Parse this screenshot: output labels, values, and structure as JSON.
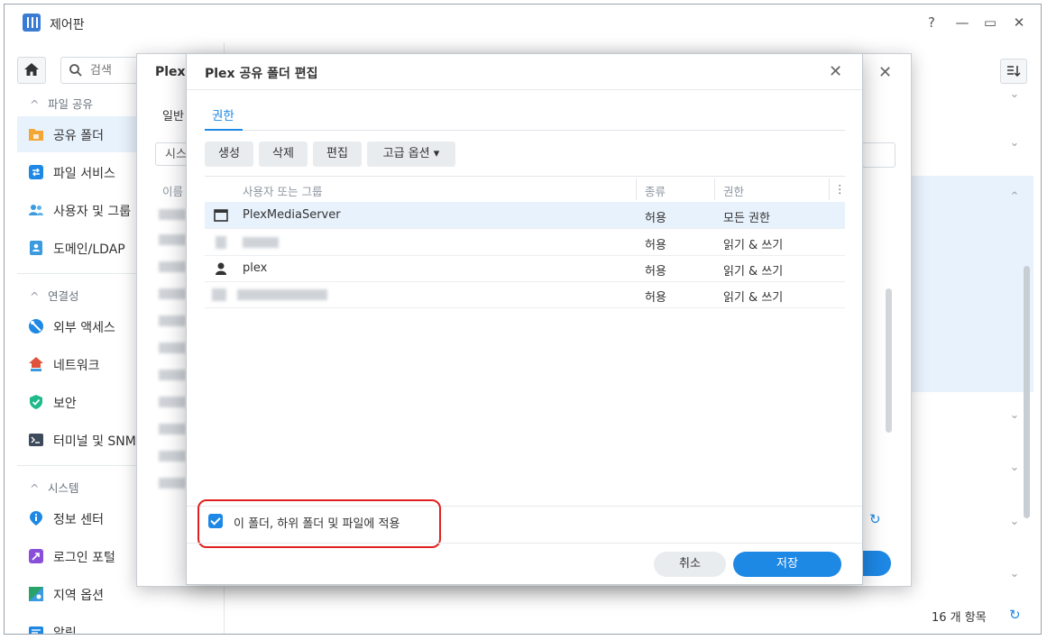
{
  "window": {
    "title": "제어판",
    "help": "?",
    "minimize": "—",
    "maximize": "▭",
    "close": "✕"
  },
  "sidebar": {
    "search_placeholder": "검색",
    "sections": [
      {
        "label": "파일 공유",
        "items": [
          {
            "label": "공유 폴더",
            "icon": "shared-folder-icon",
            "color": "#f3a633",
            "active": true
          },
          {
            "label": "파일 서비스",
            "icon": "file-services-icon",
            "color": "#1e88e5"
          },
          {
            "label": "사용자 및 그룹",
            "icon": "user-group-icon",
            "color": "#3a9be0"
          },
          {
            "label": "도메인/LDAP",
            "icon": "domain-ldap-icon",
            "color": "#3a9be0"
          }
        ]
      },
      {
        "label": "연결성",
        "items": [
          {
            "label": "외부 액세스",
            "icon": "external-access-icon",
            "color": "#1e88e5"
          },
          {
            "label": "네트워크",
            "icon": "network-icon",
            "color": "#e0533a"
          },
          {
            "label": "보안",
            "icon": "security-shield-icon",
            "color": "#1fb98a"
          },
          {
            "label": "터미널 및 SNMP",
            "icon": "terminal-icon",
            "color": "#3d4a5c"
          }
        ]
      },
      {
        "label": "시스템",
        "items": [
          {
            "label": "정보 센터",
            "icon": "info-center-icon",
            "color": "#1e88e5"
          },
          {
            "label": "로그인 포털",
            "icon": "login-portal-icon",
            "color": "#8a4fd8"
          },
          {
            "label": "지역 옵션",
            "icon": "regional-options-icon",
            "color": "#2aa36b"
          },
          {
            "label": "알림",
            "icon": "notification-icon",
            "color": "#1e88e5"
          }
        ]
      }
    ]
  },
  "right_panel": {
    "item_count": "16 개 항목"
  },
  "back_dialog": {
    "title": "Plex -",
    "tab": "일반",
    "field_text": "시스",
    "column_name": "이름"
  },
  "dialog": {
    "title": "Plex 공유 폴더 편집",
    "tab": "권한",
    "toolbar": {
      "create": "생성",
      "delete": "삭제",
      "edit": "편집",
      "advanced": "고급 옵션 ▾"
    },
    "columns": {
      "user": "사용자 또는 그룹",
      "type": "종류",
      "permission": "권한",
      "more": "⋮"
    },
    "rows": [
      {
        "name": "PlexMediaServer",
        "type": "허용",
        "permission": "모든 권한",
        "icon": "app-window-icon",
        "selected": true
      },
      {
        "name": "",
        "type": "허용",
        "permission": "읽기 & 쓰기",
        "icon": "redacted-icon",
        "blurred": true
      },
      {
        "name": "plex",
        "type": "허용",
        "permission": "읽기 & 쓰기",
        "icon": "user-icon"
      },
      {
        "name": "",
        "type": "허용",
        "permission": "읽기 & 쓰기",
        "icon": "redacted-icon",
        "blurred": true
      }
    ],
    "apply_checkbox_label": "이 폴더, 하위 폴더 및 파일에 적용",
    "apply_checked": true,
    "cancel": "취소",
    "save": "저장"
  },
  "colors": {
    "accent": "#1e88e5",
    "selected_row": "#e8f2fc",
    "highlight_border": "#e02020"
  }
}
